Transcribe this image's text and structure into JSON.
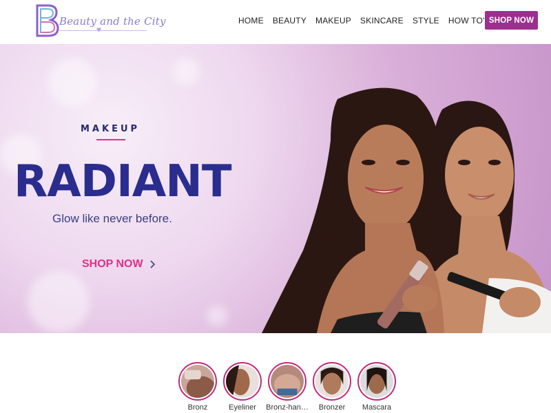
{
  "header": {
    "logo_text": "Beauty and the City",
    "nav": [
      "HOME",
      "BEAUTY",
      "MAKEUP",
      "SKINCARE",
      "STYLE",
      "HOW TO'S"
    ],
    "search_icon": "search-icon",
    "shop_button": "SHOP NOW",
    "brand_color": "#9c2f8f"
  },
  "hero": {
    "kicker": "MAKEUP",
    "title": "RADIANT",
    "subtitle": "Glow like never before.",
    "cta": "SHOP NOW",
    "title_color": "#2a2d8e",
    "accent_color": "#e0308a"
  },
  "categories": [
    {
      "label": "Bronz"
    },
    {
      "label": "Eyeliner"
    },
    {
      "label": "Bronz-han…"
    },
    {
      "label": "Bronzer"
    },
    {
      "label": "Mascara"
    }
  ]
}
